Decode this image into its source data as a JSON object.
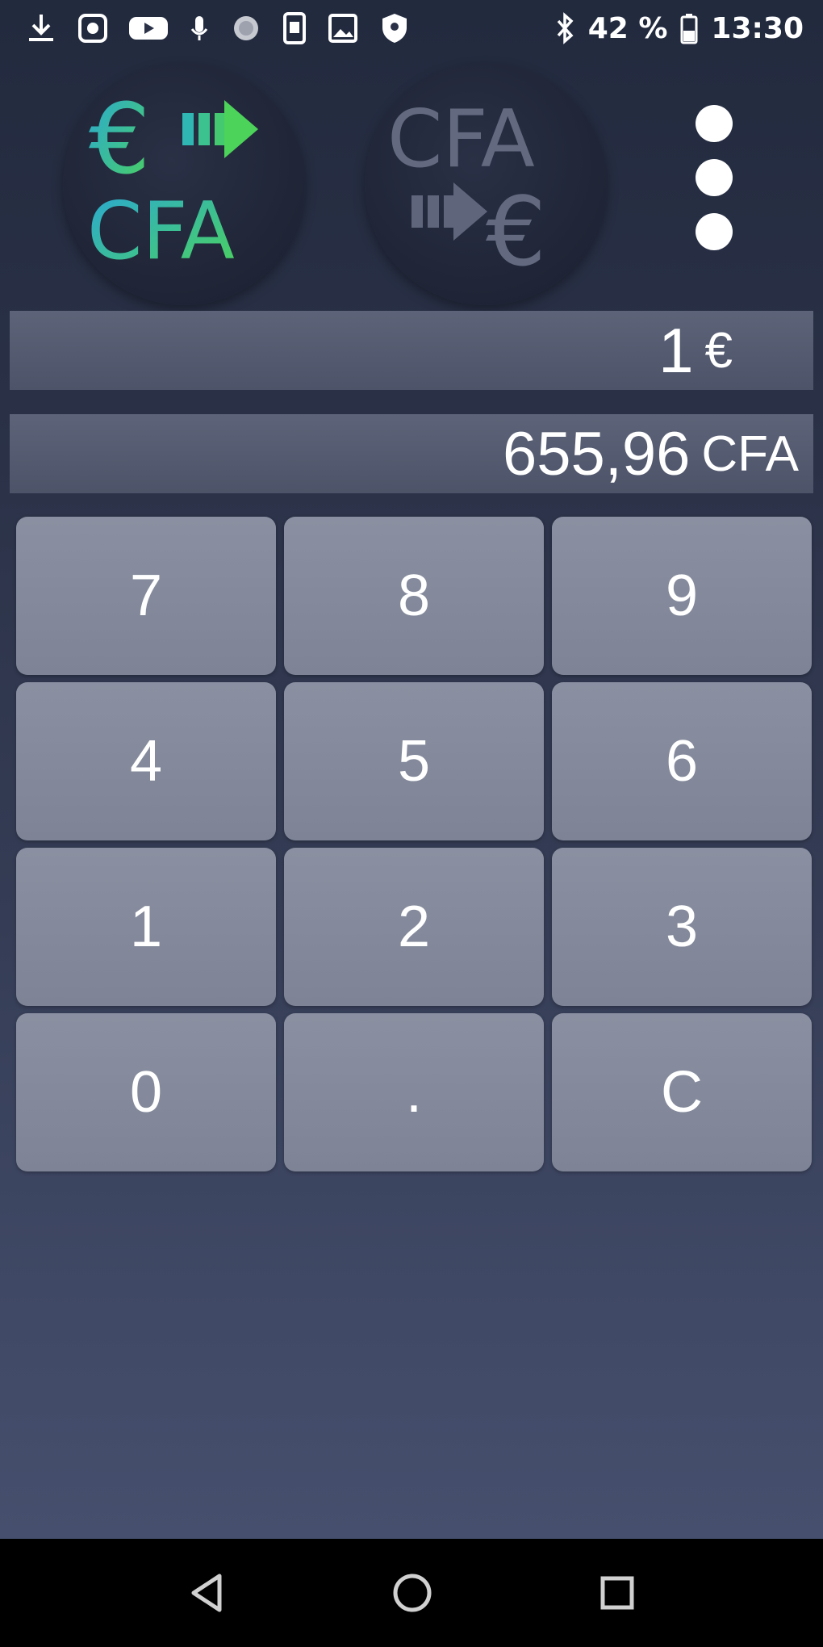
{
  "status_bar": {
    "battery": "42 %",
    "time": "13:30",
    "icons_left": [
      "download-icon",
      "media-icon",
      "youtube-icon",
      "mic-icon",
      "sync-icon",
      "phone-icon",
      "image-icon",
      "shield-icon"
    ],
    "icons_right": [
      "bluetooth-icon",
      "battery-icon"
    ]
  },
  "header": {
    "mode_eur_to_cfa": {
      "label_top": "€",
      "label_bottom": "CFA",
      "icon": "arrow-right-icon"
    },
    "mode_cfa_to_eur": {
      "label_top": "CFA",
      "label_bottom": "€",
      "icon": "arrow-right-icon"
    },
    "menu_icon": "more-vert-icon"
  },
  "input": {
    "value": "1",
    "unit": "€"
  },
  "result": {
    "value": "655,96",
    "unit": "CFA"
  },
  "keypad": [
    "7",
    "8",
    "9",
    "4",
    "5",
    "6",
    "1",
    "2",
    "3",
    "0",
    ".",
    "C"
  ],
  "colors": {
    "accent_green": "#4cd35a",
    "accent_blue": "#2aa7d6",
    "inactive": "#6c7389",
    "key_bg": "#858b9c",
    "display_bg": "#555b70"
  },
  "nav": {
    "back_icon": "back-triangle-icon",
    "home_icon": "home-circle-icon",
    "recent_icon": "recent-square-icon"
  }
}
